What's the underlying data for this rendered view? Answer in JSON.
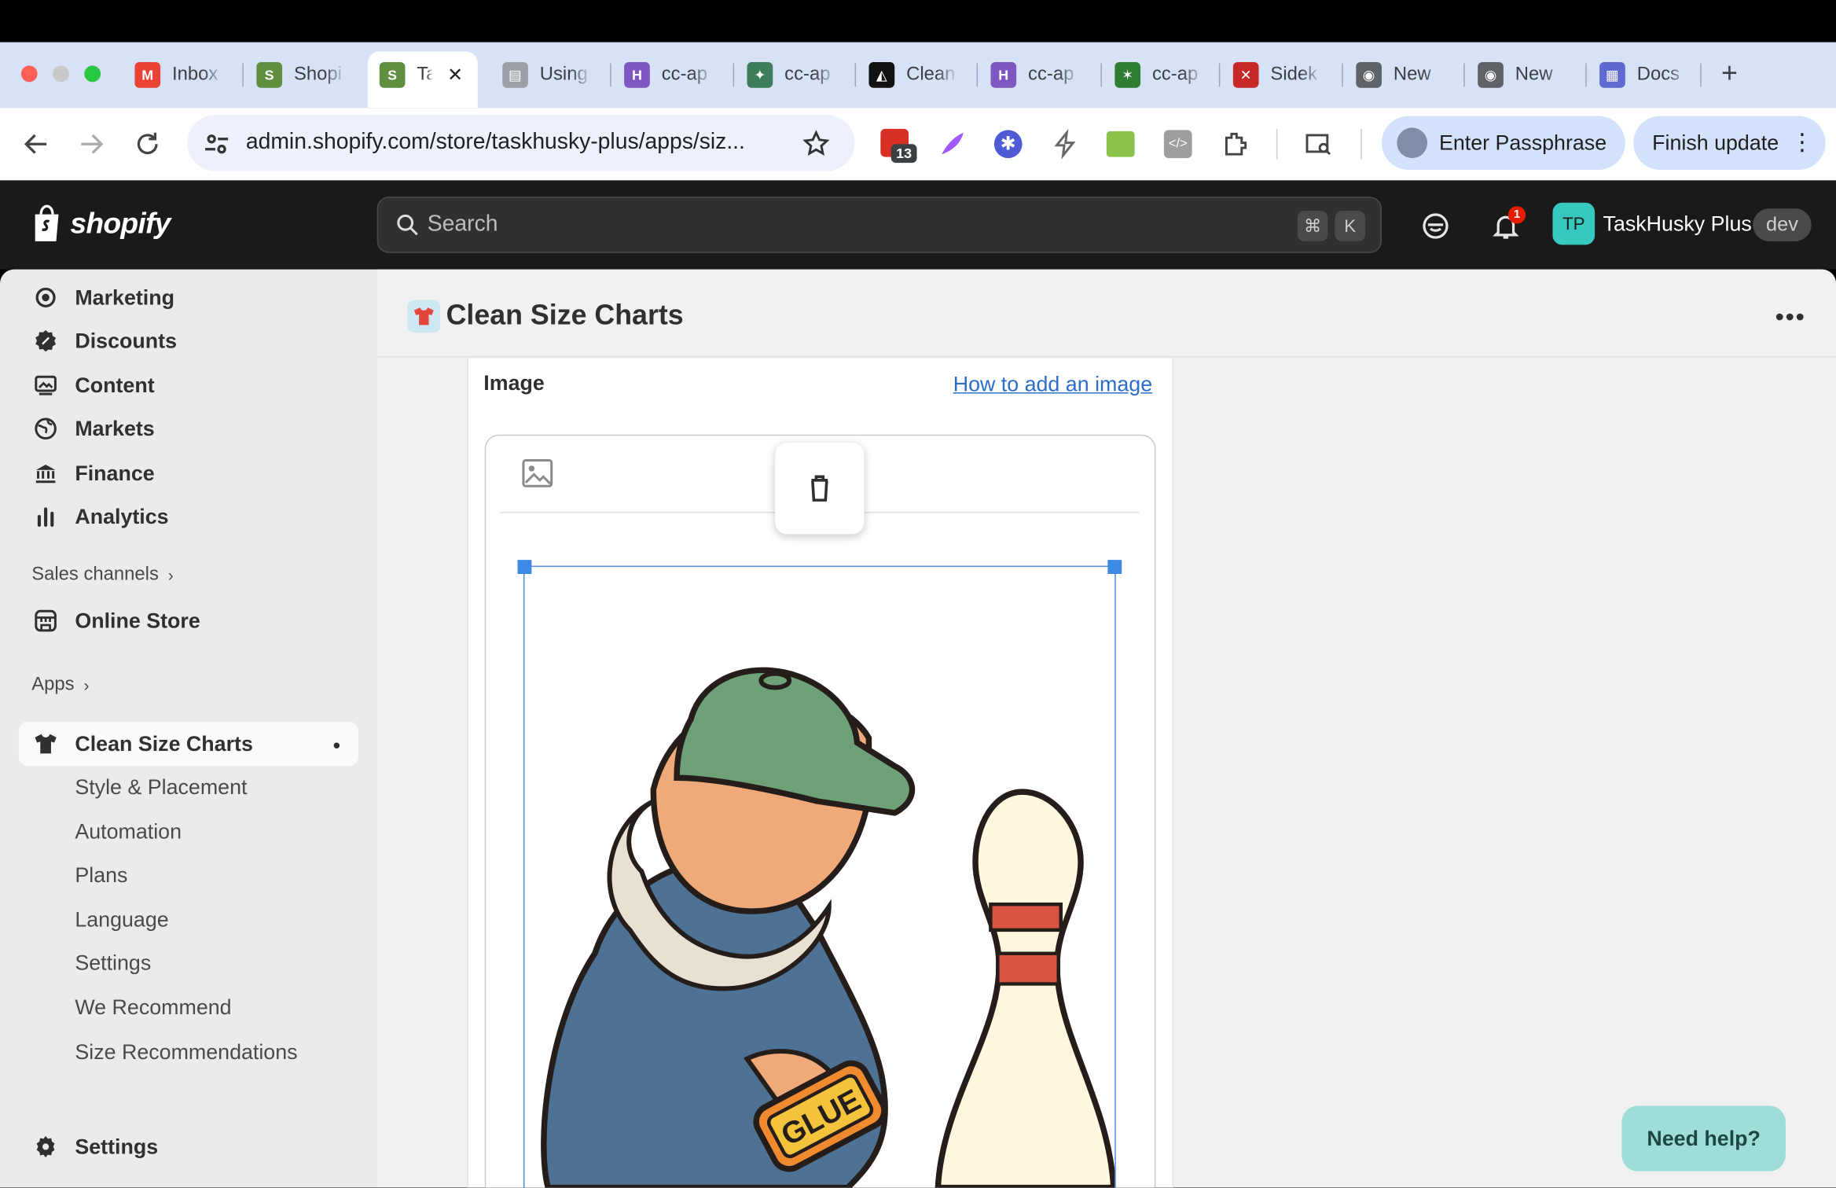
{
  "browser": {
    "tabs": [
      {
        "label": "Inbox",
        "icon": "gmail-icon"
      },
      {
        "label": "Shopi",
        "icon": "shopify-icon"
      },
      {
        "label": "Ta",
        "icon": "shopify-icon",
        "active": true
      },
      {
        "label": "Using",
        "icon": "document-icon"
      },
      {
        "label": "cc-ap",
        "icon": "h-logo-icon"
      },
      {
        "label": "cc-ap",
        "icon": "husky-icon"
      },
      {
        "label": "Clean",
        "icon": "clean-logo-icon"
      },
      {
        "label": "cc-ap",
        "icon": "h-logo-icon"
      },
      {
        "label": "cc-ap",
        "icon": "runner-icon"
      },
      {
        "label": "Sidek",
        "icon": "sidekick-icon"
      },
      {
        "label": "New",
        "icon": "chrome-icon"
      },
      {
        "label": "New",
        "icon": "chrome-icon"
      },
      {
        "label": "Docs",
        "icon": "linear-icon"
      }
    ],
    "url": "admin.shopify.com/store/taskhusky-plus/apps/siz...",
    "extension_badge": "13",
    "passphrase_label": "Enter Passphrase",
    "update_label": "Finish update"
  },
  "shopify": {
    "logo": "shopify",
    "search_placeholder": "Search",
    "shortcut_cmd": "⌘",
    "shortcut_key": "K",
    "notification_count": "1",
    "store_initials": "TP",
    "store_name": "TaskHusky Plus",
    "store_badge": "dev"
  },
  "sidebar": {
    "items": [
      {
        "label": "Marketing",
        "icon": "target-icon"
      },
      {
        "label": "Discounts",
        "icon": "discount-icon"
      },
      {
        "label": "Content",
        "icon": "content-icon"
      },
      {
        "label": "Markets",
        "icon": "globe-icon"
      },
      {
        "label": "Finance",
        "icon": "bank-icon"
      },
      {
        "label": "Analytics",
        "icon": "bar-chart-icon"
      }
    ],
    "sales_channels": "Sales channels",
    "online_store": "Online Store",
    "apps": "Apps",
    "app_name": "Clean Size Charts",
    "app_subitems": [
      "Style & Placement",
      "Automation",
      "Plans",
      "Language",
      "Settings",
      "We Recommend",
      "Size Recommendations"
    ],
    "settings": "Settings"
  },
  "main": {
    "title": "Clean Size Charts",
    "image_heading": "Image",
    "image_link": "How to add an image",
    "help": "Need help?",
    "image_text": "GLUE"
  },
  "colors": {
    "link": "#2c6ecb",
    "selection": "#3d8ae6",
    "help_bg": "#9fded8"
  }
}
